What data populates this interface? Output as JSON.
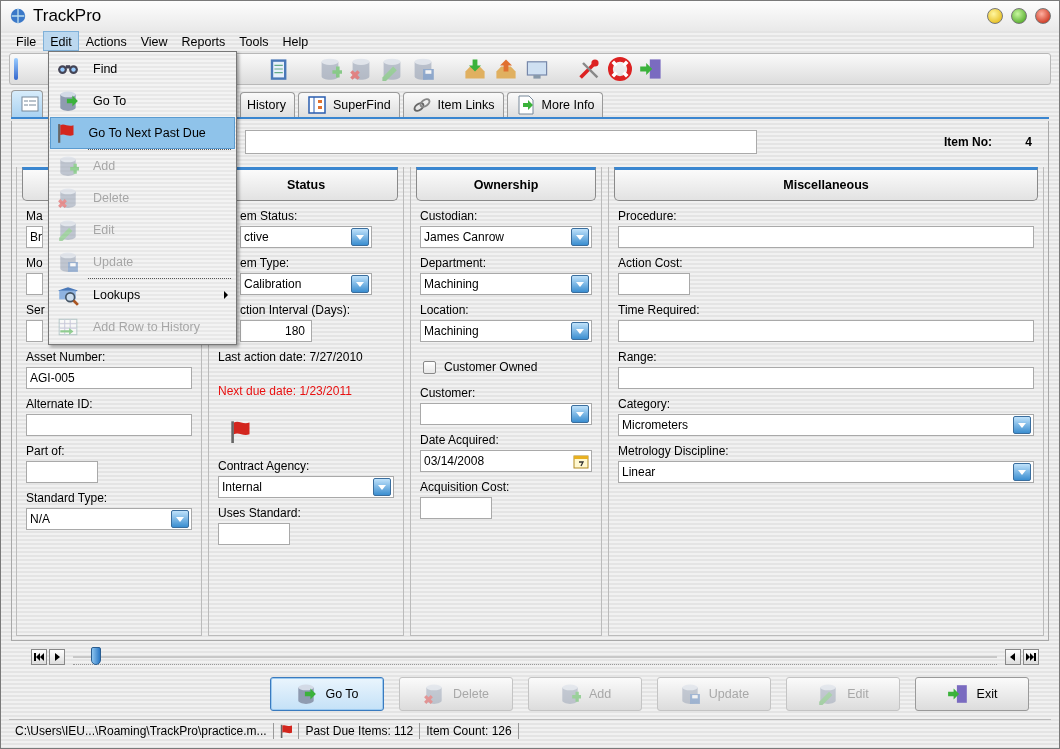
{
  "window": {
    "title": "TrackPro"
  },
  "menu_bar": [
    {
      "label": "File",
      "selected": false
    },
    {
      "label": "Edit",
      "selected": true
    },
    {
      "label": "Actions",
      "selected": false
    },
    {
      "label": "View",
      "selected": false
    },
    {
      "label": "Reports",
      "selected": false
    },
    {
      "label": "Tools",
      "selected": false
    },
    {
      "label": "Help",
      "selected": false
    }
  ],
  "edit_menu": [
    {
      "kind": "item",
      "label": "Find",
      "disabled": false,
      "highlighted": false
    },
    {
      "kind": "item",
      "label": "Go To",
      "disabled": false,
      "highlighted": false
    },
    {
      "kind": "item",
      "label": "Go To Next Past Due",
      "disabled": false,
      "highlighted": true
    },
    {
      "kind": "separator"
    },
    {
      "kind": "item",
      "label": "Add",
      "disabled": true,
      "highlighted": false
    },
    {
      "kind": "item",
      "label": "Delete",
      "disabled": true,
      "highlighted": false
    },
    {
      "kind": "item",
      "label": "Edit",
      "disabled": true,
      "highlighted": false
    },
    {
      "kind": "item",
      "label": "Update",
      "disabled": true,
      "highlighted": false
    },
    {
      "kind": "separator"
    },
    {
      "kind": "submenu",
      "label": "Lookups",
      "disabled": false,
      "highlighted": false
    },
    {
      "kind": "item",
      "label": "Add Row to History",
      "disabled": true,
      "highlighted": false
    }
  ],
  "tabs": [
    {
      "selected": true
    },
    {
      "label": "History",
      "selected": false
    },
    {
      "label": "SuperFind",
      "selected": false
    },
    {
      "label": "Item Links",
      "selected": false
    },
    {
      "label": "More Info",
      "selected": false
    }
  ],
  "item_number": {
    "label": "Item No:",
    "value": "4"
  },
  "panels": [
    {
      "fields": [
        {
          "kind": "text",
          "label": "Ma",
          "value": "Br"
        },
        {
          "kind": "text",
          "label": "Mo"
        },
        {
          "kind": "text",
          "label": "Ser"
        },
        {
          "kind": "text",
          "label": "Asset Number:",
          "value": "AGI-005"
        },
        {
          "kind": "text",
          "label": "Alternate ID:"
        },
        {
          "kind": "short",
          "label": "Part of:"
        },
        {
          "kind": "dropdown",
          "label": "Standard Type:",
          "value": "N/A"
        }
      ]
    },
    {
      "title": "Status",
      "fields": [
        {
          "kind": "dropdown",
          "label": "em Status:",
          "value": "ctive"
        },
        {
          "kind": "dropdown",
          "label": "em Type:",
          "value": "Calibration"
        },
        {
          "kind": "short",
          "label": "ction Interval (Days):",
          "value": "180"
        },
        {
          "kind": "info",
          "label": "Last action date: 7/27/2010",
          "alert": false
        },
        {
          "kind": "info",
          "label": "Next due date: 1/23/2011",
          "alert": true
        },
        {
          "kind": "flag"
        },
        {
          "kind": "dropdown",
          "label": "Contract Agency:",
          "value": "Internal"
        },
        {
          "kind": "short",
          "label": "Uses Standard:"
        }
      ]
    },
    {
      "title": "Ownership",
      "fields": [
        {
          "kind": "dropdown",
          "label": "Custodian:",
          "value": "James Canrow"
        },
        {
          "kind": "dropdown",
          "label": "Department:",
          "value": "Machining"
        },
        {
          "kind": "dropdown",
          "label": "Location:",
          "value": "Machining"
        },
        {
          "kind": "checkbox",
          "label": "Customer Owned",
          "checked": false
        },
        {
          "kind": "dropdown",
          "label": "Customer:"
        },
        {
          "kind": "date",
          "label": "Date Acquired:",
          "value": "03/14/2008"
        },
        {
          "kind": "short",
          "label": "Acquisition Cost:"
        }
      ]
    },
    {
      "title": "Miscellaneous",
      "fields": [
        {
          "kind": "text",
          "label": "Procedure:"
        },
        {
          "kind": "short",
          "label": "Action Cost:"
        },
        {
          "kind": "text",
          "label": "Time Required:"
        },
        {
          "kind": "text",
          "label": "Range:"
        },
        {
          "kind": "dropdown",
          "label": "Category:",
          "value": "Micrometers"
        },
        {
          "kind": "dropdown",
          "label": "Metrology Discipline:",
          "value": "Linear"
        }
      ]
    }
  ],
  "navigator": {
    "level": 0.025
  },
  "buttons": [
    {
      "label": "Go To",
      "disabled": false,
      "focused": true
    },
    {
      "label": "Delete",
      "disabled": true,
      "focused": false
    },
    {
      "label": "Add",
      "disabled": true,
      "focused": false
    },
    {
      "label": "Update",
      "disabled": true,
      "focused": false
    },
    {
      "label": "Edit",
      "disabled": true,
      "focused": false
    },
    {
      "label": "Exit",
      "disabled": false,
      "focused": false
    }
  ],
  "status_bar": {
    "path": "C:\\Users\\IEU...\\Roaming\\TrackPro\\practice.m...",
    "past_due": "Past Due Items: 112",
    "item_count": "Item Count: 126"
  }
}
